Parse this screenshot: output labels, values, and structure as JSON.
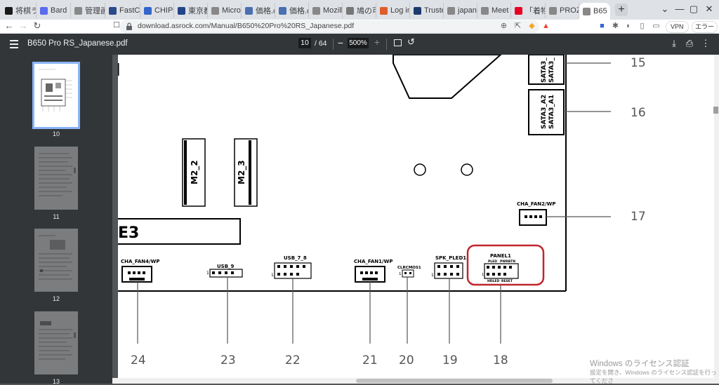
{
  "browser": {
    "tabs": [
      {
        "label": "将棋ラ",
        "icon": "app-icon",
        "color": "#1a1a1a"
      },
      {
        "label": "Bard",
        "icon": "bard-icon",
        "color": "#5b6cf0"
      },
      {
        "label": "管理画",
        "icon": "globe-icon",
        "color": "#888888"
      },
      {
        "label": "FastCo",
        "icon": "fastcopy-icon",
        "color": "#2a4a8a"
      },
      {
        "label": "CHIPs",
        "icon": "chips-icon",
        "color": "#3366cc"
      },
      {
        "label": "東京都",
        "icon": "site-icon",
        "color": "#224488"
      },
      {
        "label": "Micro",
        "icon": "globe-icon",
        "color": "#888888"
      },
      {
        "label": "価格.c",
        "icon": "kakaku-icon",
        "color": "#4a6fb0"
      },
      {
        "label": "価格.c",
        "icon": "kakaku-icon",
        "color": "#4a6fb0"
      },
      {
        "label": "Mozill",
        "icon": "globe-icon",
        "color": "#888888"
      },
      {
        "label": "鳩の可",
        "icon": "doc-icon",
        "color": "#777777"
      },
      {
        "label": "Log in",
        "icon": "login-icon",
        "color": "#e05c2a"
      },
      {
        "label": "Truste",
        "icon": "trusted-icon",
        "color": "#1d3a6e"
      },
      {
        "label": "japane",
        "icon": "globe-icon",
        "color": "#888888"
      },
      {
        "label": "Meet",
        "icon": "globe-icon",
        "color": "#888888"
      },
      {
        "label": "「着物",
        "icon": "pinterest-icon",
        "color": "#e60023"
      },
      {
        "label": "PROZ",
        "icon": "globe-icon",
        "color": "#888888"
      },
      {
        "label": "B65",
        "icon": "globe-icon",
        "color": "#888888"
      }
    ],
    "url": "download.asrock.com/Manual/B650%20Pro%20RS_Japanese.pdf",
    "vpn_label": "VPN",
    "error_label": "エラー"
  },
  "pdf": {
    "title": "B650 Pro RS_Japanese.pdf",
    "page_current": "10",
    "page_total": "/ 64",
    "zoom": "500%"
  },
  "thumbnails": [
    {
      "number": "10",
      "selected": true
    },
    {
      "number": "11",
      "selected": false
    },
    {
      "number": "12",
      "selected": false
    },
    {
      "number": "13",
      "selected": false
    }
  ],
  "diagram": {
    "connectors": {
      "m2_2": "M2_2",
      "m2_3": "M2_3",
      "sata_top": "SATA3_",
      "sata_top2": "SATA3_",
      "sata_a2": "SATA3_A2",
      "sata_a1": "SATA3_A1",
      "pcie_partial": "E3",
      "cha_fan2": "CHA_FAN2/WP",
      "cha_fan4": "CHA_FAN4/WP",
      "usb_9": "USB_9",
      "usb_7_8": "USB_7_8",
      "cha_fan1": "CHA_FAN1/WP",
      "clrcmos": "CLRCMOS1",
      "spk_pled": "SPK_PLED1",
      "panel": "PANEL1",
      "pled": "PLED",
      "pwrbtn": "PWRBTN",
      "hdled": "HDLED",
      "reset": "RESET",
      "pin1": "1"
    },
    "callouts": [
      "15",
      "16",
      "17",
      "24",
      "23",
      "22",
      "21",
      "20",
      "19",
      "18"
    ],
    "highlight_color": "#c0262d"
  },
  "watermark": {
    "line1": "Windows のライセンス認証",
    "line2": "設定を開き、Windows のライセンス認証を行ってくださ"
  }
}
